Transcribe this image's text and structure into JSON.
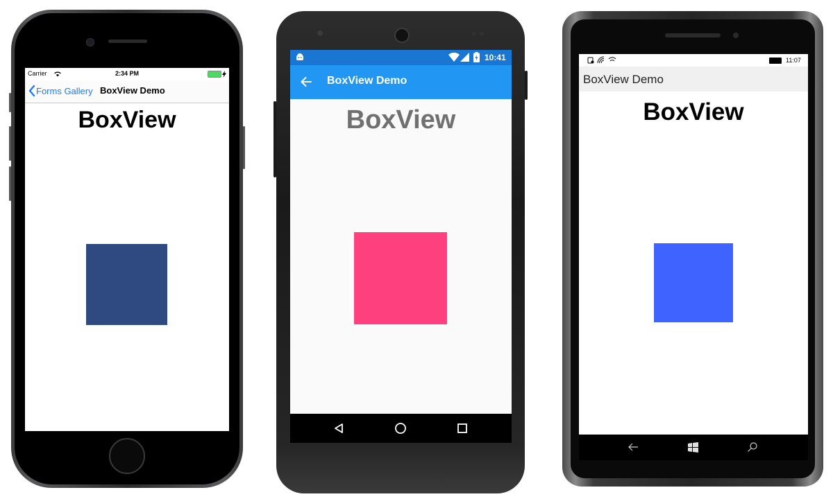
{
  "ios": {
    "carrier": "Carrier",
    "time": "2:34 PM",
    "back_label": "Forms Gallery",
    "title": "BoxView Demo",
    "heading": "BoxView",
    "box_color": "#2E4A80"
  },
  "android": {
    "time": "10:41",
    "title": "BoxView Demo",
    "heading": "BoxView",
    "appbar_color": "#2196F3",
    "statusbar_color": "#1976D2",
    "box_color": "#FE407F"
  },
  "windows": {
    "time": "11:07",
    "title": "BoxView Demo",
    "heading": "BoxView",
    "box_color": "#3F63FF"
  }
}
